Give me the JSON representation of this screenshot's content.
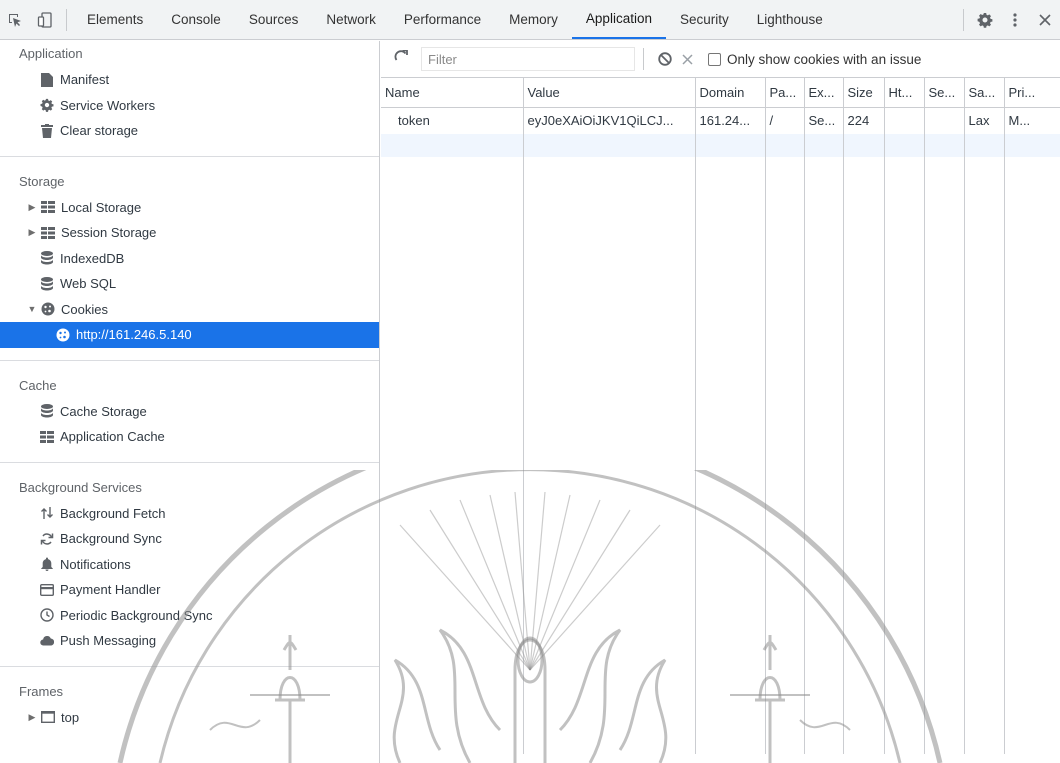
{
  "tabbar": {
    "tabs": [
      "Elements",
      "Console",
      "Sources",
      "Network",
      "Performance",
      "Memory",
      "Application",
      "Security",
      "Lighthouse"
    ],
    "active_index": 6
  },
  "sidebar": {
    "application": {
      "title": "Application",
      "items": [
        "Manifest",
        "Service Workers",
        "Clear storage"
      ]
    },
    "storage": {
      "title": "Storage",
      "items": [
        "Local Storage",
        "Session Storage",
        "IndexedDB",
        "Web SQL",
        "Cookies"
      ],
      "cookie_child": "http://161.246.5.140"
    },
    "cache": {
      "title": "Cache",
      "items": [
        "Cache Storage",
        "Application Cache"
      ]
    },
    "background": {
      "title": "Background Services",
      "items": [
        "Background Fetch",
        "Background Sync",
        "Notifications",
        "Payment Handler",
        "Periodic Background Sync",
        "Push Messaging"
      ]
    },
    "frames": {
      "title": "Frames",
      "items": [
        "top"
      ]
    }
  },
  "toolbar": {
    "filter_placeholder": "Filter",
    "checkbox_label": "Only show cookies with an issue"
  },
  "cookies": {
    "columns": [
      "Name",
      "Value",
      "Domain",
      "Pa...",
      "Ex...",
      "Size",
      "Ht...",
      "Se...",
      "Sa...",
      "Pri..."
    ],
    "rows": [
      [
        "token",
        "eyJ0eXAiOiJKV1QiLCJ...",
        "161.24...",
        "/",
        "Se...",
        "224",
        "",
        "",
        "Lax",
        "M..."
      ]
    ]
  },
  "colors": {
    "accent": "#1a73e8",
    "selected_row": "#f0f6fe",
    "border": "#cbcdd1"
  }
}
